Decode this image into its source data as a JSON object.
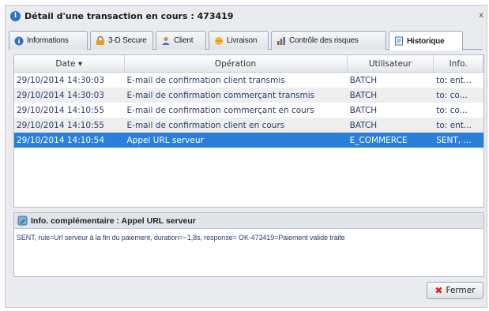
{
  "window": {
    "title": "Détail d'une transaction en cours : 473419",
    "close": "x"
  },
  "tabs": [
    {
      "label": "Informations",
      "icon": "info-icon"
    },
    {
      "label": "3-D Secure",
      "icon": "secure-icon"
    },
    {
      "label": "Client",
      "icon": "user-icon"
    },
    {
      "label": "Livraison",
      "icon": "delivery-icon"
    },
    {
      "label": "Contrôle des risques",
      "icon": "chart-icon"
    },
    {
      "label": "Historique",
      "icon": "history-icon",
      "active": true
    }
  ],
  "grid": {
    "headers": [
      "Date ▾",
      "Opération",
      "Utilisateur",
      "Info."
    ],
    "rows": [
      {
        "date": "29/10/2014 14:30:03",
        "operation": "E-mail de confirmation client transmis",
        "user": "BATCH",
        "info": "to: ent..."
      },
      {
        "date": "29/10/2014 14:30:03",
        "operation": "E-mail de confirmation commerçant transmis",
        "user": "BATCH",
        "info": "to: co..."
      },
      {
        "date": "29/10/2014 14:10:55",
        "operation": "E-mail de confirmation commerçant en cours",
        "user": "BATCH",
        "info": "to: co..."
      },
      {
        "date": "29/10/2014 14:10:55",
        "operation": "E-mail de confirmation client en cours",
        "user": "BATCH",
        "info": "to: ent..."
      },
      {
        "date": "29/10/2014 14:10:54",
        "operation": "Appel URL serveur",
        "user": "E_COMMERCE",
        "info": "SENT, ..."
      }
    ]
  },
  "info": {
    "title": "Info. complémentaire : Appel URL serveur",
    "body": "SENT, rule=Url serveur à la fin du paiement, duration=~1,8s, response= OK-473419=Paiement valide traite"
  },
  "footer": {
    "close_label": "Fermer"
  },
  "colors": {
    "selected_row": "#2b7fd8",
    "accent": "#2f6fbf"
  }
}
